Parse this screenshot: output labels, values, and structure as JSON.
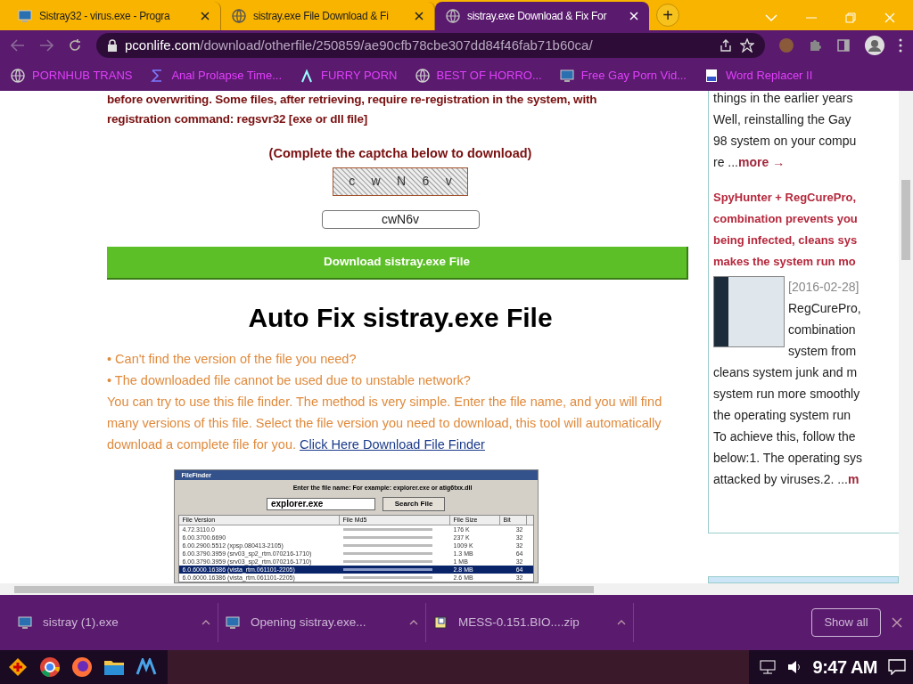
{
  "tabs": [
    {
      "title": "Sistray32 - virus.exe - Progra",
      "selected": false
    },
    {
      "title": "sistray.exe File Download & Fi",
      "selected": false
    },
    {
      "title": "sistray.exe Download & Fix For",
      "selected": true
    }
  ],
  "new_tab": "+",
  "address": {
    "domain": "pconlife.com",
    "path": "/download/otherfile/250859/ae90cfb78cbe307dd84f46fab71b60ca/"
  },
  "bookmarks": [
    {
      "label": "PORNHUB TRANS"
    },
    {
      "label": "Anal Prolapse Time..."
    },
    {
      "label": "FURRY PORN"
    },
    {
      "label": "BEST OF HORRO..."
    },
    {
      "label": "Free Gay Porn Vid..."
    },
    {
      "label": "Word Replacer II"
    }
  ],
  "main": {
    "intro_lines": [
      "before overwriting. Some files, after retrieving, require re-registration in the system, with",
      "registration command: regsvr32 [exe or dll file]"
    ],
    "captcha_prompt": "(Complete the captcha below to download)",
    "captcha_chars": [
      "c",
      "w",
      "N",
      "6",
      "v"
    ],
    "captcha_value": "cwN6v",
    "download_button": "Download sistray.exe File",
    "heading": "Auto Fix sistray.exe File",
    "bullets": [
      "• Can't find the version of the file you need?",
      "• The downloaded file cannot be used due to unstable network?"
    ],
    "paragraph": "You can try to use this file finder. The method is very simple. Enter the file name, and you will find many versions of this file. Select the file version you need to download, this tool will automatically download a complete file for you.",
    "link": "Click Here Download File Finder",
    "finder": {
      "title": "FileFinder",
      "prompt": "Enter the file name:  For example: explorer.exe or atig6txx.dll",
      "value": "explorer.exe",
      "button": "Search File",
      "columns": [
        "File Version",
        "File Md5",
        "File Size",
        "Bit"
      ],
      "rows": [
        {
          "version": "4.72.3110.0",
          "size": "176 K",
          "bit": "32",
          "selected": false
        },
        {
          "version": "6.00.3700.6690",
          "size": "237 K",
          "bit": "32",
          "selected": false
        },
        {
          "version": "6.00.2900.5512 (xpsp.080413-2105)",
          "size": "1009 K",
          "bit": "32",
          "selected": false
        },
        {
          "version": "6.00.3790.3959 (srv03_sp2_rtm.070216-1710)",
          "size": "1.3 MB",
          "bit": "64",
          "selected": false
        },
        {
          "version": "6.00.3790.3959 (srv03_sp2_rtm.070216-1710)",
          "size": "1 MB",
          "bit": "32",
          "selected": false
        },
        {
          "version": "6.0.6000.16386 (vista_rtm.061101-2205)",
          "size": "2.8 MB",
          "bit": "64",
          "selected": true
        },
        {
          "version": "6.0.6000.16386 (vista_rtm.061101-2205)",
          "size": "2.6 MB",
          "bit": "32",
          "selected": false
        }
      ]
    }
  },
  "sidebar": {
    "lines_top": [
      "things in the earlier years",
      "Well, reinstalling the Gay",
      "98 system on your compu",
      "re ..."
    ],
    "more": "more →",
    "title_lines": [
      "SpyHunter + RegCurePro,",
      "combination prevents you",
      "being infected, cleans sys",
      "makes the system run mo"
    ],
    "date": "[2016-02-28]",
    "beside_lines": [
      "RegCurePro,",
      "combination",
      "system from"
    ],
    "lines_bottom": [
      "cleans system junk and m",
      "system run more smoothly",
      "the operating system run",
      "To achieve this, follow the",
      "below:1. The operating sys",
      "attacked by viruses.2.  ..."
    ],
    "more2": "m"
  },
  "downloads": [
    {
      "name": "sistray (1).exe"
    },
    {
      "name": "Opening sistray.exe..."
    },
    {
      "name": "MESS-0.151.BIO....zip"
    }
  ],
  "show_all": "Show all",
  "clock": "9:47 AM"
}
